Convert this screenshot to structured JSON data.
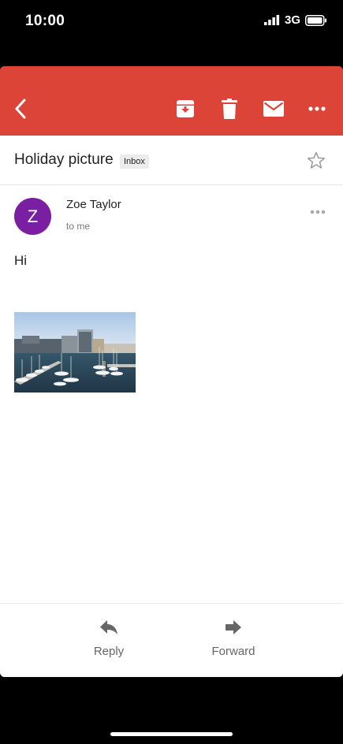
{
  "status_bar": {
    "time": "10:00",
    "network": "3G"
  },
  "toolbar": {
    "back_icon": "back-arrow-icon",
    "archive_icon": "archive-icon",
    "delete_icon": "trash-icon",
    "mark_unread_icon": "mail-icon",
    "more_icon": "more-horizontal-icon",
    "color": "#db4437"
  },
  "email": {
    "subject": "Holiday picture",
    "label": "Inbox",
    "sender": "Zoe Taylor",
    "avatar_letter": "Z",
    "avatar_color": "#7b1fa2",
    "recipient": "to me",
    "body": "Hi"
  },
  "actions": {
    "reply": "Reply",
    "forward": "Forward"
  }
}
